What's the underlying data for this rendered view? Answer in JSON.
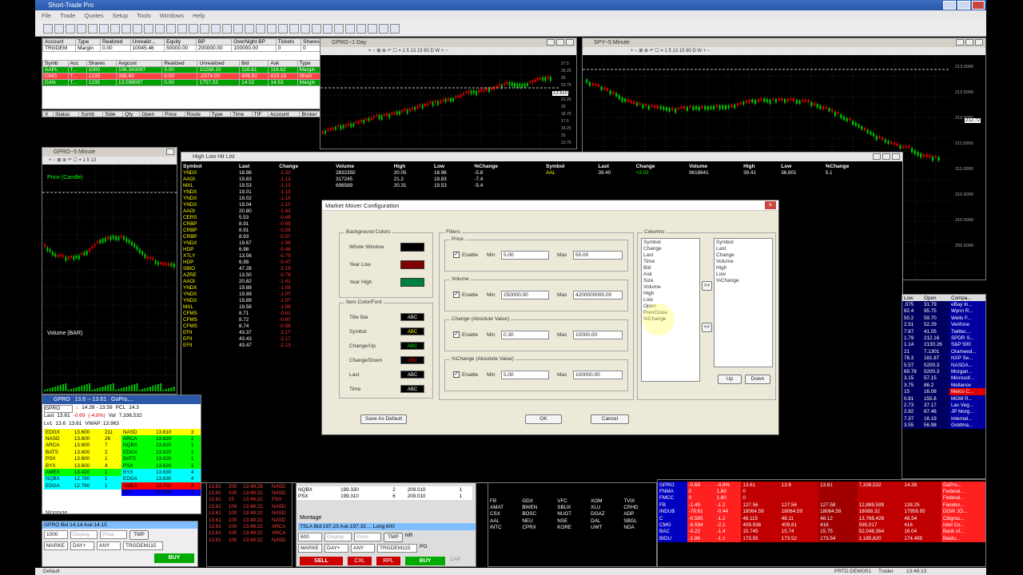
{
  "app": {
    "title": "Short-Trade Pro",
    "menu": [
      "File",
      "Trade",
      "Quotes",
      "Setup",
      "Tools",
      "Windows",
      "Help"
    ]
  },
  "colors": {
    "up": "#00c000",
    "down": "#e00000",
    "grid": "#404040",
    "dialog_bg": "#ece9d8"
  },
  "account": {
    "headers": [
      "Account",
      "Type",
      "Realized",
      "Unrealiz...",
      "Equity",
      "BP",
      "OverNight BP",
      "Tickets",
      "Shares"
    ],
    "row": [
      "TRGDEM",
      "Margin",
      "0.00",
      "10045.46",
      "50000.00",
      "200000.00",
      "100000.00",
      "0",
      "0"
    ]
  },
  "positions": {
    "headers": [
      "Symb",
      "Acc",
      "Shares",
      "Avgcost",
      "Realized",
      "Unrealized",
      "Bid",
      "Ask",
      "Type"
    ],
    "rows": [
      [
        "AAPL",
        "T...",
        "1000",
        "106.343097",
        "0.00",
        "10268.10",
        "116.61",
        "116.62",
        "Margin"
      ],
      [
        "CMG",
        "T...",
        "1235",
        "398.60",
        "0.00",
        "-2374.00",
        "409.82",
        "410.18",
        "Short"
      ],
      [
        "DAN",
        "T...",
        "1235",
        "13.098097",
        "0.00",
        "1757.02",
        "14.52",
        "14.53",
        "Margin"
      ]
    ]
  },
  "orders_headers": [
    "X",
    "Status",
    "Symb",
    "Side",
    "Qty",
    "Open",
    "Price",
    "Route",
    "Type",
    "Time",
    "TIF",
    "Account",
    "Broker"
  ],
  "windows": {
    "gpro_day": "GPRO--1 Day",
    "spy_5": "SPY--5 Minute",
    "gpro_5": "GPRO--5 Minute",
    "high_low": "High Low Hit List",
    "price_label": "Price (Candle)",
    "volume_label": "Volume (BAR)",
    "price_tag_1": "13.610",
    "price_tag_2": "212.72"
  },
  "highlow": {
    "headers": [
      "Symbol",
      "Last",
      "Change",
      "Volume",
      "High",
      "Low",
      "%Change"
    ],
    "rows": [
      [
        "YNDX",
        "18.98",
        "-1.20",
        "2832350",
        "20.05",
        "18.96",
        "-5.8"
      ],
      [
        "AAOI",
        "19.83",
        "-1.13",
        "317245",
        "21.2",
        "19.83",
        "-7.4"
      ],
      [
        "MXL",
        "19.53",
        "-1.13",
        "698589",
        "20.31",
        "19.53",
        "-5.4"
      ],
      [
        "YNDX",
        "19.01",
        "-1.15",
        "",
        "",
        "",
        ""
      ],
      [
        "YNDX",
        "19.02",
        "-1.15",
        "",
        "",
        "",
        ""
      ],
      [
        "YNDX",
        "19.04",
        "-1.15",
        "",
        "",
        "",
        ""
      ],
      [
        "AAOI",
        "20.80",
        "-1.43",
        "",
        "",
        "",
        ""
      ],
      [
        "CERS",
        "5.53",
        "-0.48",
        "",
        "",
        "",
        ""
      ],
      [
        "CRBP",
        "8.91",
        "-0.59",
        "",
        "",
        "",
        ""
      ],
      [
        "CRBP",
        "8.91",
        "-0.59",
        "",
        "",
        "",
        ""
      ],
      [
        "CRBP",
        "8.93",
        "-0.57",
        "",
        "",
        "",
        ""
      ],
      [
        "YNDX",
        "19.67",
        "-1.09",
        "",
        "",
        "",
        ""
      ],
      [
        "HDP",
        "6.98",
        "-0.46",
        "",
        "",
        "",
        ""
      ],
      [
        "XTLY",
        "13.56",
        "-0.79",
        "",
        "",
        "",
        ""
      ],
      [
        "HDP",
        "6.99",
        "-0.47",
        "",
        "",
        "",
        ""
      ],
      [
        "SBIO",
        "47.28",
        "-2.19",
        "",
        "",
        "",
        ""
      ],
      [
        "AZRE",
        "13.50",
        "-0.78",
        "",
        "",
        "",
        ""
      ],
      [
        "AAOI",
        "20.82",
        "-1.41",
        "",
        "",
        "",
        ""
      ],
      [
        "YNDX",
        "19.88",
        "-1.08",
        "",
        "",
        "",
        ""
      ],
      [
        "YNDX",
        "19.89",
        "-1.07",
        "",
        "",
        "",
        ""
      ],
      [
        "YNDX",
        "19.89",
        "-1.07",
        "",
        "",
        "",
        ""
      ],
      [
        "MXL",
        "19.58",
        "-1.08",
        "",
        "",
        "",
        ""
      ],
      [
        "CFMS",
        "8.71",
        "-0.61",
        "",
        "",
        "",
        ""
      ],
      [
        "CFMS",
        "8.72",
        "-0.60",
        "",
        "",
        "",
        ""
      ],
      [
        "CFMS",
        "8.74",
        "-0.58",
        "",
        "",
        "",
        ""
      ],
      [
        "EFII",
        "43.37",
        "-2.17",
        "",
        "",
        "",
        ""
      ],
      [
        "EFII",
        "43.43",
        "-2.17",
        "",
        "",
        "",
        ""
      ],
      [
        "EFII",
        "43.47",
        "-2.13",
        "",
        "",
        "",
        ""
      ]
    ],
    "right_row": [
      "AAL",
      "39.40",
      "+2.02",
      "9618641",
      "39.41",
      "36.801",
      "5.1"
    ]
  },
  "dialog": {
    "title": "Market Mover Configuration",
    "bg_colors_label": "Background Colors",
    "bg_items": [
      {
        "label": "Whole Window",
        "color": "#000000"
      },
      {
        "label": "Year Low",
        "color": "#800000"
      },
      {
        "label": "Year High",
        "color": "#008040"
      }
    ],
    "item_color_label": "Item Color/Font",
    "font_items": [
      {
        "label": "Title Bar",
        "sample": "ABC",
        "color": "#ffffff"
      },
      {
        "label": "Symbol",
        "sample": "ABC",
        "color": "#ffff00"
      },
      {
        "label": "Change/Up",
        "sample": "ABC",
        "color": "#00ff00"
      },
      {
        "label": "Change/Down",
        "sample": "ABC",
        "color": "#ff0000"
      },
      {
        "label": "Last",
        "sample": "ABC",
        "color": "#ffffff"
      },
      {
        "label": "Time",
        "sample": "ABC",
        "color": "#ffffff"
      }
    ],
    "save_default": "Save As Default",
    "filters_label": "Filters",
    "filters": [
      {
        "name": "Price",
        "enable": "Enable",
        "min_label": "Min",
        "min": "5.00",
        "max_label": "Max",
        "max": "50.00"
      },
      {
        "name": "Volume",
        "enable": "Enable",
        "min_label": "Min",
        "min": "250000.00",
        "max_label": "Max",
        "max": "4200000000.00"
      },
      {
        "name": "Change (Absolute Value)",
        "enable": "Enable",
        "min_label": "Min",
        "min": "0.30",
        "max_label": "Max",
        "max": "10000.00"
      },
      {
        "name": "%Change (Absolute Value)",
        "enable": "Enable",
        "min_label": "Min",
        "min": "5.00",
        "max_label": "Max",
        "max": "100000.00"
      }
    ],
    "columns_label": "Columns",
    "available": [
      "Symbol",
      "Change",
      "Last",
      "Time",
      "Bid",
      "Ask",
      "Size",
      "Volume",
      "High",
      "Low",
      "Open",
      "PrevClose",
      "%Change"
    ],
    "selected": [
      "Symbol",
      "Last",
      "Change",
      "Volume",
      "High",
      "Low",
      "%Change"
    ],
    "add": ">>",
    "remove": "<<",
    "up": "Up",
    "down": "Down",
    "ok": "OK",
    "cancel": "Cancel"
  },
  "level2": {
    "title": "GPRO",
    "range": "13.6 -- 13.61",
    "company": "GoPro,...",
    "symbol": "GPRO",
    "hilo": "14.39 - 13.59",
    "pcl_label": "PCL",
    "pcl": "14.3",
    "last_label": "Last",
    "last": "13.61",
    "change": "-0.69",
    "pct": "(-4.8%)",
    "vol_label": "Vol",
    "vol": "7,336,532",
    "lv1_label": "Lv1",
    "bid": "13.6",
    "ask": "13.61",
    "vwap": "VWAP: 13.963",
    "bids": [
      [
        "EDGX",
        "13.600",
        "211",
        "#ffff00"
      ],
      [
        "NASD",
        "13.600",
        "26",
        "#ffff00"
      ],
      [
        "ARCA",
        "13.600",
        "7",
        "#ffff00"
      ],
      [
        "BATS",
        "13.600",
        "2",
        "#ffff00"
      ],
      [
        "PSX",
        "13.600",
        "1",
        "#ffff00"
      ],
      [
        "BYX",
        "13.600",
        "4",
        "#ffff00"
      ],
      [
        "AMEX",
        "13.420",
        "1",
        "#00ff00"
      ],
      [
        "NQBX",
        "12.790",
        "1",
        "#00ffff"
      ],
      [
        "EDGA",
        "12.790",
        "1",
        "#00ffff"
      ]
    ],
    "asks": [
      [
        "NASD",
        "13.610",
        "3",
        "#ffff00"
      ],
      [
        "ARCA",
        "13.620",
        "2",
        "#00ff00"
      ],
      [
        "NQBX",
        "13.620",
        "1",
        "#00ff00"
      ],
      [
        "EDGX",
        "13.620",
        "1",
        "#00ff00"
      ],
      [
        "BATS",
        "13.620",
        "1",
        "#00ff00"
      ],
      [
        "PSX",
        "13.620",
        "1",
        "#00ff00"
      ],
      [
        "BYX",
        "13.630",
        "4",
        "#00ffff"
      ],
      [
        "EDGA",
        "13.630",
        "4",
        "#00ffff"
      ],
      [
        "AMEX",
        "13.700",
        "3",
        "#ff0000"
      ],
      [
        "IEX",
        "30.000",
        "2",
        "#0000ff"
      ]
    ],
    "montage": "Montage",
    "bidask_line": "GPRO Bid:14.14 Ask:14.15",
    "tsla_line": "TSLA Bid:197.23 Ask:197.33 ... Long 600",
    "qty": "1000",
    "qty2": "600",
    "price_ph": "Price",
    "display_ph": "Display",
    "tmp": "TMP",
    "route": "MARKE",
    "tif": "DAY+",
    "any": "ANY",
    "account": "TRGDEM115",
    "buy": "BUY",
    "sell": "SELL",
    "cxl": "CXL",
    "rpl": "RPL",
    "nr": "NR",
    "po": "PO",
    "cap": "CAP"
  },
  "tape": [
    [
      "13.61",
      "200",
      "13:49:28",
      "NASD"
    ],
    [
      "13.61",
      "100",
      "13:49:22",
      "NASD"
    ],
    [
      "13.61",
      "15",
      "13:49:22",
      "PSX"
    ],
    [
      "13.61",
      "100",
      "13:49:22",
      "NASD"
    ],
    [
      "13.61",
      "100",
      "13:49:22",
      "NASD"
    ],
    [
      "13.61",
      "100",
      "13:49:22",
      "NASD"
    ],
    [
      "13.61",
      "100",
      "13:49:22",
      "ARCA"
    ],
    [
      "13.61",
      "100",
      "13:49:22",
      "ARCA"
    ],
    [
      "13.61",
      "100",
      "13:49:22",
      "NASD"
    ]
  ],
  "market_maker": {
    "rows": [
      [
        "NQBX",
        "199.330",
        "2",
        "209.010",
        "1"
      ],
      [
        "PSX",
        "199.310",
        "6",
        "209.010",
        "1"
      ]
    ]
  },
  "grid_symbols": [
    [
      "FB",
      "GDX",
      "VFC",
      "XOM",
      "TVIX"
    ],
    [
      "AMAT",
      "BWEN",
      "SBUX",
      "XLU",
      "CRHD"
    ],
    [
      "CSX",
      "BOSC",
      "NUGT",
      "DGAZ",
      "ADP"
    ],
    [
      "AAL",
      "NEU",
      "NSE",
      "DAL",
      "SBGL"
    ],
    [
      "INTC",
      "CPRX",
      "KORE",
      "UWT",
      "NDA"
    ]
  ],
  "watchlist": {
    "rows": [
      [
        "GPRO",
        "-0.69",
        "-4.8%",
        "13.61",
        "13.6",
        "13.61",
        "7,336,532",
        "14.39",
        "GoPro..."
      ],
      [
        "FNMA",
        "0",
        "1.80",
        "0",
        "",
        "",
        "",
        "",
        "Federal..."
      ],
      [
        "FMCC",
        "0",
        "1.80",
        "0",
        "",
        "",
        "",
        "",
        "Federal..."
      ],
      [
        "FB",
        "-1.49",
        "-1.2",
        "127.56",
        "127.56",
        "127.58",
        "12,889,599",
        "128.25",
        "Facebo..."
      ],
      [
        "INDU$",
        "-79.61",
        "-0.44",
        "18064.59",
        "18064.59",
        "18064.59",
        "18088.32",
        "17959.95",
        "DOW JO..."
      ],
      [
        "C",
        "-0.585",
        "-1.2",
        "48.115",
        "48.11",
        "48.12",
        "13,768,426",
        "48.54",
        "Citigrou..."
      ],
      [
        "CMG",
        "-8.594",
        "-2.1",
        "409.936",
        "409.81",
        "416",
        "595,017",
        "416",
        "Intel Co..."
      ],
      [
        "BAC",
        "-0.22",
        "-1.4",
        "15.745",
        "15.74",
        "15.75",
        "52,048,364",
        "16.04",
        "Bank of..."
      ],
      [
        "BIDU",
        "-1.86",
        "-1.1",
        "173.55",
        "173.52",
        "173.54",
        "1,185,620",
        "174.495",
        "Baidu..."
      ]
    ]
  },
  "quote_list": {
    "headers": [
      "Low",
      "Open",
      "Compa..."
    ],
    "rows": [
      [
        ".075",
        "31.79",
        "eBay In..."
      ],
      [
        "82.4",
        "95.75",
        "Wynn R..."
      ],
      [
        "50.2",
        "59.70",
        "Wells F..."
      ],
      [
        "2.51",
        "52.29",
        "Verifone"
      ],
      [
        "7.67",
        "41.05",
        "Twitter,..."
      ],
      [
        "1.79",
        "212.16",
        "SPDR S..."
      ],
      [
        "1.14",
        "2130.26",
        "S&P 500"
      ],
      [
        "21",
        "7.1301",
        "Orameed..."
      ],
      [
        "78.3",
        "181.87",
        "NXP Se..."
      ],
      [
        "5.57",
        "5200.3",
        "NASDA..."
      ],
      [
        "69.78",
        "5200.3",
        "Morgan..."
      ],
      [
        "3.15",
        "57.15",
        "Microsof..."
      ],
      [
        "3.75",
        "86.2",
        "Mellanox"
      ],
      [
        "15",
        "16.08",
        "Melco C..."
      ],
      [
        "0.81",
        "155.6",
        "MGM R..."
      ],
      [
        "2.73",
        "37.17",
        "Las Veg..."
      ],
      [
        "2.82",
        "67.46",
        "JP Morg..."
      ],
      [
        "7.37",
        "16.19",
        "Internat..."
      ],
      [
        "3.55",
        "56.98",
        "Goldma..."
      ]
    ]
  },
  "spy_axis": [
    "213.0000",
    "212.5000",
    "212.0000",
    "211.5000",
    "211.0000",
    "210.5000",
    "210.0000",
    "209.5000"
  ],
  "gpro_axis": [
    "27.5",
    "26.25",
    "25",
    "23.75",
    "22.5",
    "21.25",
    "20",
    "18.75",
    "17.5",
    "16.25",
    "15",
    "13.75"
  ],
  "status": {
    "left": "Default",
    "conn": "PRTD.DEMO51",
    "role": "Trader",
    "time": "13:48:13"
  }
}
